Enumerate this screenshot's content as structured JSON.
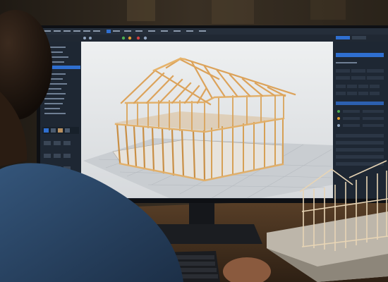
{
  "scene": {
    "subject": "monitor-with-3d-cad-house-frame",
    "colors": {
      "wall": "#2b241b",
      "desk": "#4a3420",
      "monitor_bezel": "#0e1014",
      "ui_panel": "#1e2733",
      "ui_accent": "#2f6fd0",
      "viewport_bg": "#dfe1e3",
      "timber": "#d9a35a",
      "shirt": "#2d4a6a"
    }
  },
  "cad_ui": {
    "left_panel_icons": [
      "layers-icon",
      "folder-icon",
      "cube-icon",
      "pen-icon",
      "ruler-icon",
      "grid-icon"
    ],
    "toolbar_icons": [
      "undo-icon",
      "redo-icon",
      "select-icon",
      "move-icon",
      "rotate-icon",
      "render-icon"
    ],
    "right_panel_icons": [
      "settings-icon",
      "material-icon",
      "light-icon"
    ]
  }
}
